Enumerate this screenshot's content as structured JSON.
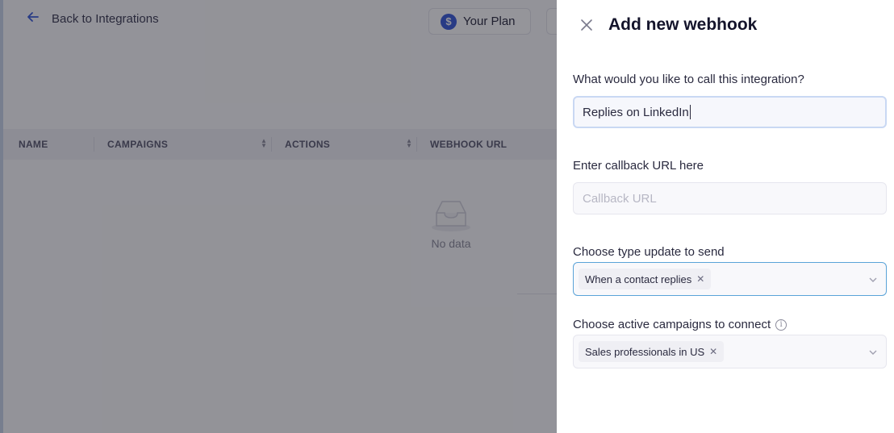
{
  "background": {
    "back_label": "Back to Integrations",
    "plan_label": "Your Plan",
    "plan_icon": "$",
    "columns": [
      "NAME",
      "CAMPAIGNS",
      "ACTIONS",
      "WEBHOOK URL"
    ],
    "empty_text": "No data"
  },
  "drawer": {
    "title": "Add new webhook",
    "name_label": "What would you like to call this integration?",
    "name_value": "Replies on LinkedIn",
    "callback_label": "Enter callback URL here",
    "callback_placeholder": "Callback URL",
    "type_label": "Choose type update to send",
    "type_tags": [
      "When a contact replies"
    ],
    "campaigns_label": "Choose active campaigns to connect",
    "campaign_tags": [
      "Sales professionals in US"
    ],
    "info_glyph": "i",
    "remove_glyph": "✕"
  },
  "colors": {
    "accent": "#3a5bd9",
    "focus_border": "#5aa3d8",
    "overlay": "rgba(20,20,30,0.45)"
  }
}
